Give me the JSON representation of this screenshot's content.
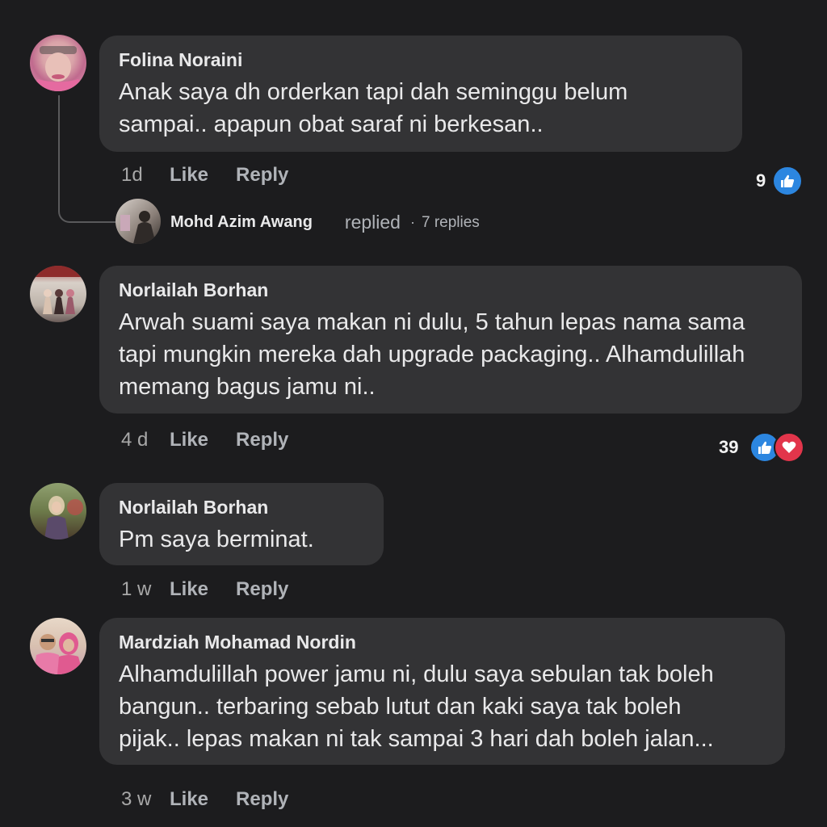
{
  "comments": [
    {
      "author": "Folina Noraini",
      "lines": [
        "Anak saya dh orderkan tapi dah seminggu belum",
        "sampai.. apapun obat saraf ni berkesan.."
      ],
      "time": "1d",
      "like": "Like",
      "reply": "Reply",
      "reaction_count": "9",
      "reactions": [
        "like-icon"
      ]
    },
    {
      "author": "Norlailah Borhan",
      "lines": [
        "Arwah suami saya makan ni dulu, 5 tahun lepas nama sama",
        "tapi mungkin mereka dah upgrade packaging.. Alhamdulillah",
        "memang bagus jamu ni.."
      ],
      "time": "4 d",
      "like": "Like",
      "reply": "Reply",
      "reaction_count": "39",
      "reactions": [
        "like-icon",
        "love-icon"
      ]
    },
    {
      "author": "Norlailah Borhan",
      "lines": [
        "Pm saya berminat."
      ],
      "time": "1 w",
      "like": "Like",
      "reply": "Reply"
    },
    {
      "author": "Mardziah Mohamad Nordin",
      "lines": [
        "Alhamdulillah power jamu ni, dulu saya sebulan tak boleh",
        "bangun.. terbaring sebab lutut dan kaki saya tak boleh",
        "pijak.. lepas makan ni tak sampai 3 hari dah boleh jalan..."
      ],
      "time": "3 w",
      "like": "Like",
      "reply": "Reply"
    }
  ],
  "reply_summary": {
    "name": "Mohd Azim Awang",
    "action": "replied",
    "separator": "·",
    "count": "7 replies"
  },
  "colors": {
    "background": "#1c1c1e",
    "bubble": "#333335",
    "like_blue": "#2c86e0",
    "love_red": "#e2354b"
  }
}
